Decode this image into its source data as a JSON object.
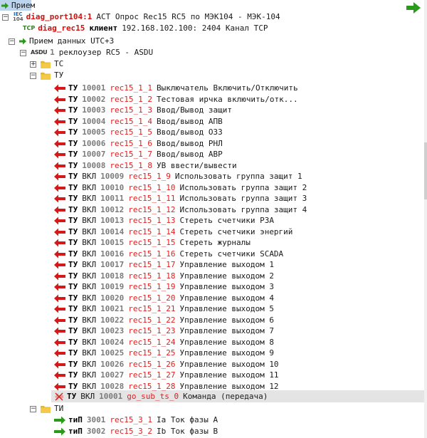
{
  "root": {
    "label": "Прием"
  },
  "port": {
    "tag_top": "IEC",
    "tag_bottom": "104",
    "name": "diag_port104:1",
    "desc": "АСТ Опрос Rec15 RC5 по МЭК104 - МЭК-104"
  },
  "client": {
    "tag": "TCP",
    "name": "diag_rec15",
    "kind": "клиент",
    "addr": "192.168.102.100: 2404 Канал TCP"
  },
  "receive": {
    "label": "Прием данных UTC+3"
  },
  "asdu": {
    "tag": "ASDU",
    "num": "1",
    "desc": "реклоузер RC5 - ASDU"
  },
  "folder_ts": {
    "label": "ТС"
  },
  "folder_tu": {
    "label": "ТУ"
  },
  "folder_ti": {
    "label": "ТИ"
  },
  "tu_items": [
    {
      "type": "ТУ",
      "vkl": "",
      "num": "10001",
      "tag": "rec15_1_1",
      "desc": "Выключатель Включить/Отключить"
    },
    {
      "type": "ТУ",
      "vkl": "",
      "num": "10002",
      "tag": "rec15_1_2",
      "desc": "Тестовая ирчка включить/отк..."
    },
    {
      "type": "ТУ",
      "vkl": "",
      "num": "10003",
      "tag": "rec15_1_3",
      "desc": "Ввод/Вывод защит"
    },
    {
      "type": "ТУ",
      "vkl": "",
      "num": "10004",
      "tag": "rec15_1_4",
      "desc": "Ввод/вывод АПВ"
    },
    {
      "type": "ТУ",
      "vkl": "",
      "num": "10005",
      "tag": "rec15_1_5",
      "desc": "Ввод/вывод ОЗЗ"
    },
    {
      "type": "ТУ",
      "vkl": "",
      "num": "10006",
      "tag": "rec15_1_6",
      "desc": "Ввод/вывод РНЛ"
    },
    {
      "type": "ТУ",
      "vkl": "",
      "num": "10007",
      "tag": "rec15_1_7",
      "desc": "Ввод/вывод АВР"
    },
    {
      "type": "ТУ",
      "vkl": "",
      "num": "10008",
      "tag": "rec15_1_8",
      "desc": "УВ ввести/вывести"
    },
    {
      "type": "ТУ",
      "vkl": "ВКЛ",
      "num": "10009",
      "tag": "rec15_1_9",
      "desc": "Использовать группа защит 1"
    },
    {
      "type": "ТУ",
      "vkl": "ВКЛ",
      "num": "10010",
      "tag": "rec15_1_10",
      "desc": "Использовать группа защит 2"
    },
    {
      "type": "ТУ",
      "vkl": "ВКЛ",
      "num": "10011",
      "tag": "rec15_1_11",
      "desc": "Использовать группа защит 3"
    },
    {
      "type": "ТУ",
      "vkl": "ВКЛ",
      "num": "10012",
      "tag": "rec15_1_12",
      "desc": "Использовать группа защит 4"
    },
    {
      "type": "ТУ",
      "vkl": "ВКЛ",
      "num": "10013",
      "tag": "rec15_1_13",
      "desc": "Стереть счетчики РЗА"
    },
    {
      "type": "ТУ",
      "vkl": "ВКЛ",
      "num": "10014",
      "tag": "rec15_1_14",
      "desc": "Стереть счетчики энергий"
    },
    {
      "type": "ТУ",
      "vkl": "ВКЛ",
      "num": "10015",
      "tag": "rec15_1_15",
      "desc": "Стереть журналы"
    },
    {
      "type": "ТУ",
      "vkl": "ВКЛ",
      "num": "10016",
      "tag": "rec15_1_16",
      "desc": "Стереть счетчики SCADA"
    },
    {
      "type": "ТУ",
      "vkl": "ВКЛ",
      "num": "10017",
      "tag": "rec15_1_17",
      "desc": "Управление выходом 1"
    },
    {
      "type": "ТУ",
      "vkl": "ВКЛ",
      "num": "10018",
      "tag": "rec15_1_18",
      "desc": "Управление выходом 2"
    },
    {
      "type": "ТУ",
      "vkl": "ВКЛ",
      "num": "10019",
      "tag": "rec15_1_19",
      "desc": "Управление выходом 3"
    },
    {
      "type": "ТУ",
      "vkl": "ВКЛ",
      "num": "10020",
      "tag": "rec15_1_20",
      "desc": "Управление выходом 4"
    },
    {
      "type": "ТУ",
      "vkl": "ВКЛ",
      "num": "10021",
      "tag": "rec15_1_21",
      "desc": "Управление выходом 5"
    },
    {
      "type": "ТУ",
      "vkl": "ВКЛ",
      "num": "10022",
      "tag": "rec15_1_22",
      "desc": "Управление выходом 6"
    },
    {
      "type": "ТУ",
      "vkl": "ВКЛ",
      "num": "10023",
      "tag": "rec15_1_23",
      "desc": "Управление выходом 7"
    },
    {
      "type": "ТУ",
      "vkl": "ВКЛ",
      "num": "10024",
      "tag": "rec15_1_24",
      "desc": "Управление выходом 8"
    },
    {
      "type": "ТУ",
      "vkl": "ВКЛ",
      "num": "10025",
      "tag": "rec15_1_25",
      "desc": "Управление выходом 9"
    },
    {
      "type": "ТУ",
      "vkl": "ВКЛ",
      "num": "10026",
      "tag": "rec15_1_26",
      "desc": "Управление выходом 10"
    },
    {
      "type": "ТУ",
      "vkl": "ВКЛ",
      "num": "10027",
      "tag": "rec15_1_27",
      "desc": "Управление выходом 11"
    },
    {
      "type": "ТУ",
      "vkl": "ВКЛ",
      "num": "10028",
      "tag": "rec15_1_28",
      "desc": "Управление выходом 12"
    }
  ],
  "tu_special": {
    "type": "ТУ",
    "vkl": "ВКЛ",
    "num": "10001",
    "tag": "go_sub_ts_0",
    "desc": "Команда (передача)"
  },
  "ti_items": [
    {
      "type": "тиП",
      "num": "3001",
      "tag": "rec15_3_1",
      "desc": "Ia Ток фазы A"
    },
    {
      "type": "тиП",
      "num": "3002",
      "tag": "rec15_3_2",
      "desc": "Ib Ток фазы B"
    }
  ],
  "colors": {
    "tag_red": "#e02020",
    "arrow_red": "#d81818",
    "arrow_green": "#2a9a1a",
    "folder": "#e8b430",
    "selection": "#bcd4ec"
  }
}
